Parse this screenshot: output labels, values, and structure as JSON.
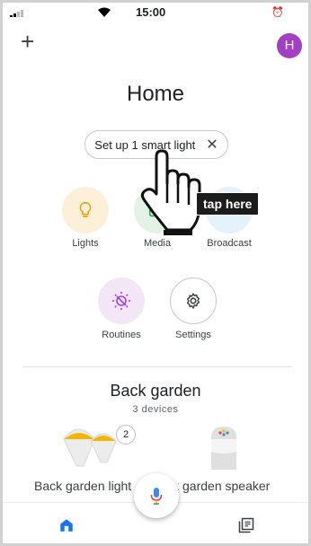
{
  "status_bar": {
    "time": "15:00"
  },
  "header": {
    "avatar_initial": "H"
  },
  "page": {
    "title": "Home"
  },
  "setup_chip": {
    "label": "Set up 1 smart light",
    "close": "✕"
  },
  "actions": [
    {
      "label": "Lights",
      "icon": "lightbulb-icon",
      "bg": "#fdf0d9",
      "color": "#e8a317"
    },
    {
      "label": "Media",
      "icon": "media-icon",
      "bg": "#e2f3e6",
      "color": "#34a853"
    },
    {
      "label": "Broadcast",
      "icon": "broadcast-icon",
      "bg": "#e3f2fb",
      "color": "#4285f4"
    },
    {
      "label": "Routines",
      "icon": "routines-icon",
      "bg": "#f3e6f7",
      "color": "#a142f4"
    },
    {
      "label": "Settings",
      "icon": "gear-icon",
      "bg": "#ffffff",
      "color": "#3c4043"
    }
  ],
  "room": {
    "title": "Back garden",
    "subtitle": "3 devices",
    "devices": [
      {
        "label": "Back garden light",
        "badge": "2",
        "icon": "bulb-group-icon"
      },
      {
        "label": "Back garden speaker",
        "icon": "speaker-icon"
      }
    ]
  },
  "overlay": {
    "tooltip": "tap here"
  },
  "colors": {
    "accent": "#1a73e8",
    "avatar": "#a33fc2"
  }
}
